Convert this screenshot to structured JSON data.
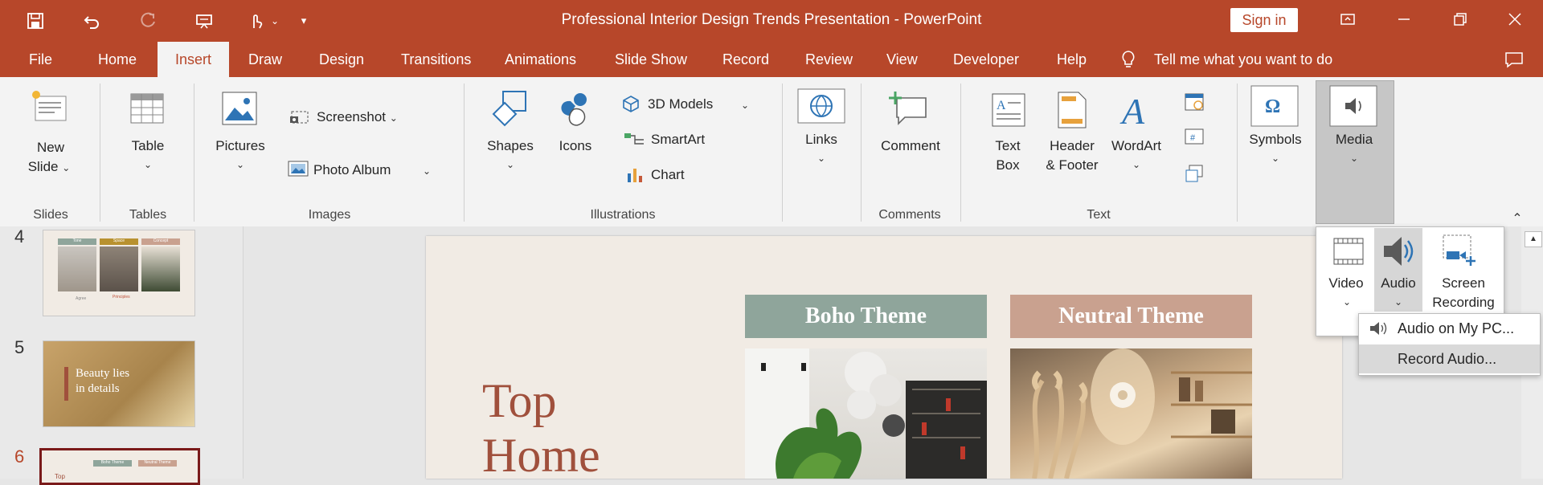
{
  "window": {
    "title": "Professional Interior Design Trends Presentation  -  PowerPoint",
    "sign_in": "Sign in",
    "bg_color": "#b7472a"
  },
  "quick_access": [
    "save-icon",
    "undo-icon",
    "redo-icon",
    "present-icon",
    "touch-mode-icon",
    "customize-icon"
  ],
  "tabs": [
    {
      "label": "File"
    },
    {
      "label": "Home"
    },
    {
      "label": "Insert",
      "active": true
    },
    {
      "label": "Draw"
    },
    {
      "label": "Design"
    },
    {
      "label": "Transitions"
    },
    {
      "label": "Animations"
    },
    {
      "label": "Slide Show"
    },
    {
      "label": "Record"
    },
    {
      "label": "Review"
    },
    {
      "label": "View"
    },
    {
      "label": "Developer"
    },
    {
      "label": "Help"
    }
  ],
  "tell_me": "Tell me what you want to do",
  "ribbon": {
    "new_slide_1": "New",
    "new_slide_2": "Slide",
    "table": "Table",
    "pictures": "Pictures",
    "screenshot": "Screenshot",
    "photo_album": "Photo Album",
    "shapes": "Shapes",
    "icons": "Icons",
    "models_3d": "3D Models",
    "smartart": "SmartArt",
    "chart": "Chart",
    "links": "Links",
    "comment": "Comment",
    "textbox_1": "Text",
    "textbox_2": "Box",
    "header_1": "Header",
    "header_2": "& Footer",
    "wordart": "WordArt",
    "symbols": "Symbols",
    "media": "Media",
    "groups": {
      "slides": "Slides",
      "tables": "Tables",
      "images": "Images",
      "illustrations": "Illustrations",
      "comments": "Comments",
      "text": "Text"
    }
  },
  "media_dropdown": {
    "video": "Video",
    "audio": "Audio",
    "screen_1": "Screen",
    "screen_2": "Recording"
  },
  "audio_menu": {
    "item1": "Audio on My PC...",
    "item2": "Record Audio..."
  },
  "thumbnails": [
    {
      "num": "4",
      "headers": [
        "Tone",
        "Space",
        "Concept"
      ],
      "footer_left": "Agree",
      "footer_right": "Principles"
    },
    {
      "num": "5",
      "text1": "Beauty lies",
      "text2": "in details"
    },
    {
      "num": "6",
      "text": "Top",
      "h1": "Boho Theme",
      "h2": "Neutral Theme"
    }
  ],
  "slide": {
    "title_1": "Top",
    "title_2": "Home",
    "card1": "Boho Theme",
    "card2": "Neutral Theme",
    "title_color": "#a0503c",
    "card1_color": "#8fa59b",
    "card2_color": "#c9a18f"
  }
}
